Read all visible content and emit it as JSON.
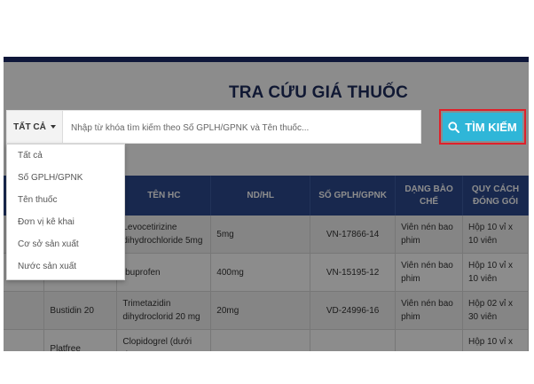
{
  "page_title": "TRA CỨU GIÁ THUỐC",
  "filter": {
    "selected": "TẤT CẢ",
    "options": [
      "Tất cả",
      "Số GPLH/GPNK",
      "Tên thuốc",
      "Đơn vị kê khai",
      "Cơ sở sản xuất",
      "Nước sản xuất"
    ]
  },
  "search": {
    "placeholder": "Nhập từ khóa tìm kiếm theo Số GPLH/GPNK và Tên thuốc...",
    "value": "",
    "button_label": "TÌM KIẾM"
  },
  "table": {
    "headers": [
      "",
      "",
      "TÊN HC",
      "ND/HL",
      "SỐ GPLH/GPNK",
      "DẠNG BÀO CHẾ",
      "QUY CÁCH ĐÓNG GÓI"
    ],
    "rows": [
      [
        "",
        "",
        "Levocetirizine dihydrochloride 5mg",
        "5mg",
        "VN-17866-14",
        "Viên nén bao phim",
        "Hộp 10 vỉ x 10 viên"
      ],
      [
        "",
        "400mg",
        "Ibuprofen",
        "400mg",
        "VN-15195-12",
        "Viên nén bao phim",
        "Hộp 10 vỉ x 10 viên"
      ],
      [
        "",
        "Bustidin 20",
        "Trimetazidin dihydroclorid 20 mg",
        "20mg",
        "VD-24996-16",
        "Viên nén bao phim",
        "Hộp 02 vỉ x 30 viên"
      ],
      [
        "",
        "Platfree",
        "Clopidogrel (dưới dạng",
        "",
        "",
        "",
        "Hộp 10 vỉ x 10"
      ]
    ]
  },
  "colors": {
    "header_bg": "#2d4a8f",
    "button_bg": "#2fb6d8",
    "highlight_border": "#e0202a",
    "title_color": "#1e2d5e"
  }
}
